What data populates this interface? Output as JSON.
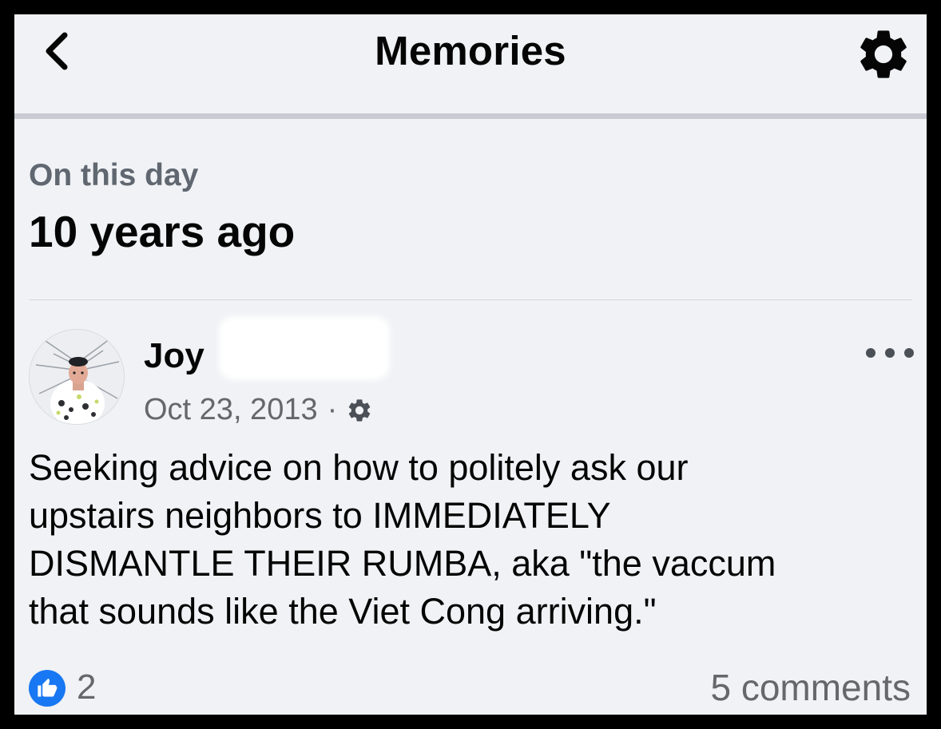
{
  "header": {
    "title": "Memories",
    "back_icon": "chevron-left-icon",
    "settings_icon": "gear-icon"
  },
  "memory": {
    "label": "On this day",
    "time_ago": "10 years ago"
  },
  "post": {
    "author_name": "Joy",
    "date": "Oct 23, 2013",
    "separator": "·",
    "privacy_icon": "gear-icon",
    "more_icon": "more-horizontal-icon",
    "text_lines": [
      "Seeking advice on how to politely ask our",
      "upstairs neighbors to IMMEDIATELY",
      "DISMANTLE THEIR RUMBA, aka \"the vaccum",
      "that sounds like the Viet Cong arriving.\""
    ]
  },
  "footer": {
    "like_icon": "thumbs-up-icon",
    "like_count": "2",
    "comments": "5 comments"
  },
  "colors": {
    "background": "#f0f2f5",
    "text_primary": "#050505",
    "text_secondary": "#65676b",
    "accent_like": "#1877f2",
    "frame": "#000000"
  }
}
